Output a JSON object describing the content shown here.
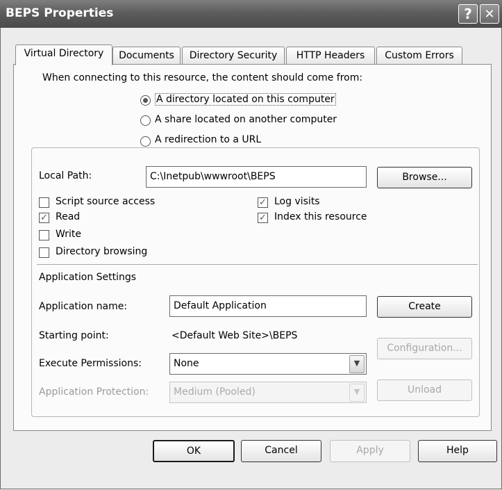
{
  "window": {
    "title": "BEPS Properties",
    "help_glyph": "?",
    "close_glyph": "✕"
  },
  "tabs": [
    {
      "label": "Virtual Directory",
      "active": true
    },
    {
      "label": "Documents",
      "active": false
    },
    {
      "label": "Directory Security",
      "active": false
    },
    {
      "label": "HTTP Headers",
      "active": false
    },
    {
      "label": "Custom Errors",
      "active": false
    }
  ],
  "content_source": {
    "prompt": "When connecting to this resource, the content should come from:",
    "options": [
      {
        "label": "A directory located on this computer",
        "selected": true
      },
      {
        "label": "A share located on another computer",
        "selected": false
      },
      {
        "label": "A redirection to a URL",
        "selected": false
      }
    ]
  },
  "local_path": {
    "label": "Local Path:",
    "value": "C:\\Inetpub\\wwwroot\\BEPS",
    "browse_label": "Browse..."
  },
  "checkboxes": [
    {
      "label": "Script source access",
      "checked": false
    },
    {
      "label": "Read",
      "checked": true
    },
    {
      "label": "Write",
      "checked": false
    },
    {
      "label": "Directory browsing",
      "checked": false
    },
    {
      "label": "Log visits",
      "checked": true
    },
    {
      "label": "Index this resource",
      "checked": true
    }
  ],
  "app_settings": {
    "heading": "Application Settings",
    "name_label": "Application name:",
    "name_value": "Default Application",
    "create_label": "Create",
    "starting_point_label": "Starting point:",
    "starting_point_value": "<Default Web Site>\\BEPS",
    "configuration_label": "Configuration...",
    "execute_label": "Execute Permissions:",
    "execute_value": "None",
    "protection_label": "Application Protection:",
    "protection_value": "Medium (Pooled)",
    "unload_label": "Unload"
  },
  "footer": {
    "ok": "OK",
    "cancel": "Cancel",
    "apply": "Apply",
    "help": "Help"
  },
  "colors": {
    "titlebar": "#5d5d5d",
    "panel": "#fbfbfb",
    "disabled_text": "#a8a8a8"
  }
}
